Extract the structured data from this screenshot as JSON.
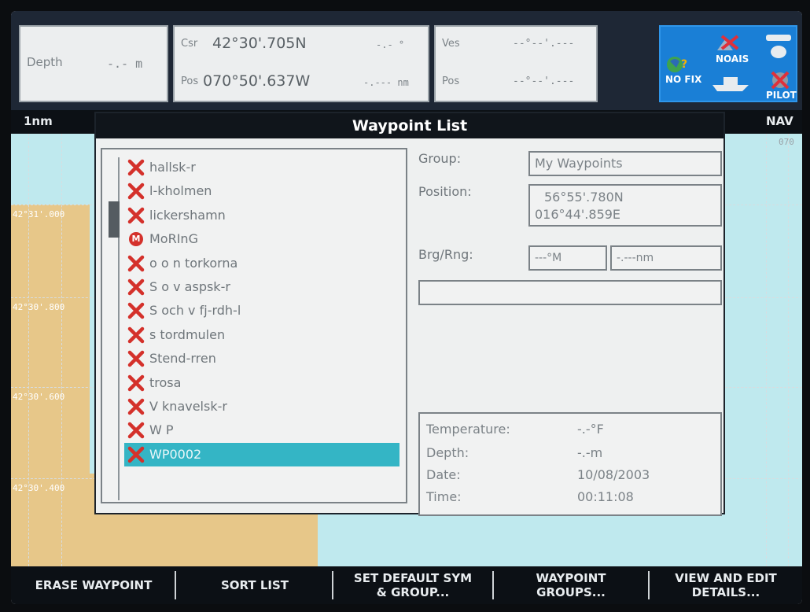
{
  "databar": {
    "depth": {
      "label": "Depth",
      "value": "-.- m"
    },
    "position": {
      "csr_label": "Csr",
      "csr_value": "42°30'.705N",
      "csr_bearing": "-.- °",
      "pos_label": "Pos",
      "pos_value": "070°50'.637W",
      "pos_range": "-.--- nm"
    },
    "vessel": {
      "ves_label": "Ves",
      "ves_value": "--°--'.---",
      "pos_label": "Pos",
      "pos_value": "--°--'.---"
    },
    "status": {
      "nofix": "NO FIX",
      "noais": "NOAIS",
      "pilot": "PILOT"
    }
  },
  "chart": {
    "range_label": "1nm",
    "mode_label": "NAV",
    "grid_labels": [
      "42°31'.000",
      "42°30'.800",
      "42°30'.600",
      "42°30'.400"
    ],
    "right_label": "070"
  },
  "dialog": {
    "title": "Waypoint List",
    "waypoints": [
      {
        "name": "hallsk-r",
        "symbol": "x"
      },
      {
        "name": "l-kholmen",
        "symbol": "x"
      },
      {
        "name": "lickershamn",
        "symbol": "x"
      },
      {
        "name": "MoRInG",
        "symbol": "m"
      },
      {
        "name": "o o n torkorna",
        "symbol": "x"
      },
      {
        "name": "S o v aspsk-r",
        "symbol": "x"
      },
      {
        "name": "S och v fj-rdh-l",
        "symbol": "x"
      },
      {
        "name": "s tordmulen",
        "symbol": "x"
      },
      {
        "name": "Stend-rren",
        "symbol": "x"
      },
      {
        "name": "trosa",
        "symbol": "x"
      },
      {
        "name": "V knavelsk-r",
        "symbol": "x"
      },
      {
        "name": "W P",
        "symbol": "x"
      },
      {
        "name": "WP0002",
        "symbol": "x"
      }
    ],
    "selected_index": 12,
    "group_label": "Group:",
    "group_value": "My Waypoints",
    "position_label": "Position:",
    "position_lat": "56°55'.780N",
    "position_lon": "016°44'.859E",
    "brg_rng_label": "Brg/Rng:",
    "brg_value": "---°M",
    "rng_value": "-.---nm",
    "comment_value": "",
    "info": {
      "temperature_label": "Temperature:",
      "temperature_value": "-.-°F",
      "depth_label": "Depth:",
      "depth_value": "-.-m",
      "date_label": "Date:",
      "date_value": "10/08/2003",
      "time_label": "Time:",
      "time_value": "00:11:08"
    }
  },
  "softkeys": [
    "ERASE WAYPOINT",
    "SORT LIST",
    "SET DEFAULT SYM\n& GROUP...",
    "WAYPOINT\nGROUPS...",
    "VIEW AND EDIT\nDETAILS..."
  ],
  "colors": {
    "selection": "#34b5c5",
    "waypoint_x": "#d4312b",
    "status_bg": "#1a7fd6"
  }
}
